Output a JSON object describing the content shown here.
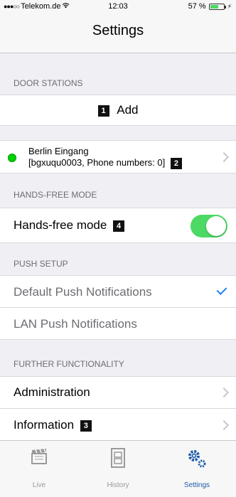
{
  "status_bar": {
    "carrier": "Telekom.de",
    "time": "12:03",
    "battery": "57 %"
  },
  "nav": {
    "title": "Settings"
  },
  "sections": {
    "door_stations": {
      "header": "DOOR STATIONS",
      "add_label": "Add",
      "add_badge": "1",
      "station": {
        "name": "Berlin Eingang",
        "detail": "[bgxuqu0003, Phone numbers: 0]",
        "badge": "2",
        "status_color": "#00d000"
      }
    },
    "hands_free": {
      "header": "HANDS-FREE MODE",
      "label": "Hands-free mode",
      "badge": "4",
      "toggle_on": true
    },
    "push_setup": {
      "header": "PUSH SETUP",
      "items": [
        {
          "label": "Default Push Notifications",
          "selected": true
        },
        {
          "label": "LAN Push Notifications",
          "selected": false
        }
      ]
    },
    "further": {
      "header": "FURTHER FUNCTIONALITY",
      "administration": "Administration",
      "information": "Information",
      "information_badge": "3"
    }
  },
  "tabs": [
    {
      "label": "Live",
      "icon": "clapperboard-icon",
      "active": false
    },
    {
      "label": "History",
      "icon": "film-strip-icon",
      "active": false
    },
    {
      "label": "Settings",
      "icon": "gears-icon",
      "active": true
    }
  ],
  "colors": {
    "accent": "#1a7ff6",
    "toggle_on": "#4cd964",
    "active_tab": "#1c5ba8"
  }
}
